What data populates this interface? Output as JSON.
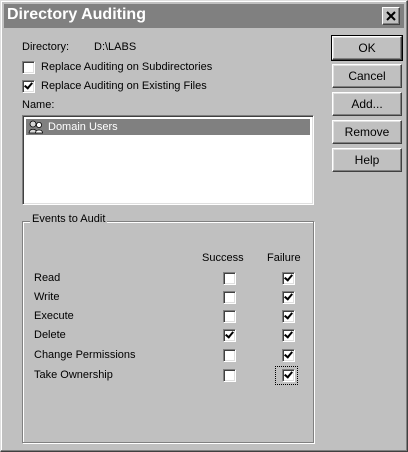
{
  "window": {
    "title": "Directory Auditing"
  },
  "directory": {
    "label": "Directory:",
    "value": "D:\\LABS"
  },
  "options": [
    {
      "label": "Replace Auditing on Subdirectories",
      "checked": false
    },
    {
      "label": "Replace Auditing on Existing Files",
      "checked": true
    }
  ],
  "names": {
    "label": "Name:",
    "items": [
      {
        "label": "Domain Users",
        "selected": true,
        "icon": "user-group-icon"
      }
    ]
  },
  "buttons": {
    "ok": "OK",
    "cancel": "Cancel",
    "add": "Add...",
    "remove": "Remove",
    "help": "Help"
  },
  "events": {
    "group_label": "Events to Audit",
    "success_header": "Success",
    "failure_header": "Failure",
    "rows": [
      {
        "label": "Read",
        "success": false,
        "failure": true
      },
      {
        "label": "Write",
        "success": false,
        "failure": true
      },
      {
        "label": "Execute",
        "success": false,
        "failure": true
      },
      {
        "label": "Delete",
        "success": true,
        "failure": true
      },
      {
        "label": "Change Permissions",
        "success": false,
        "failure": true
      },
      {
        "label": "Take Ownership",
        "success": false,
        "failure": true
      }
    ]
  }
}
